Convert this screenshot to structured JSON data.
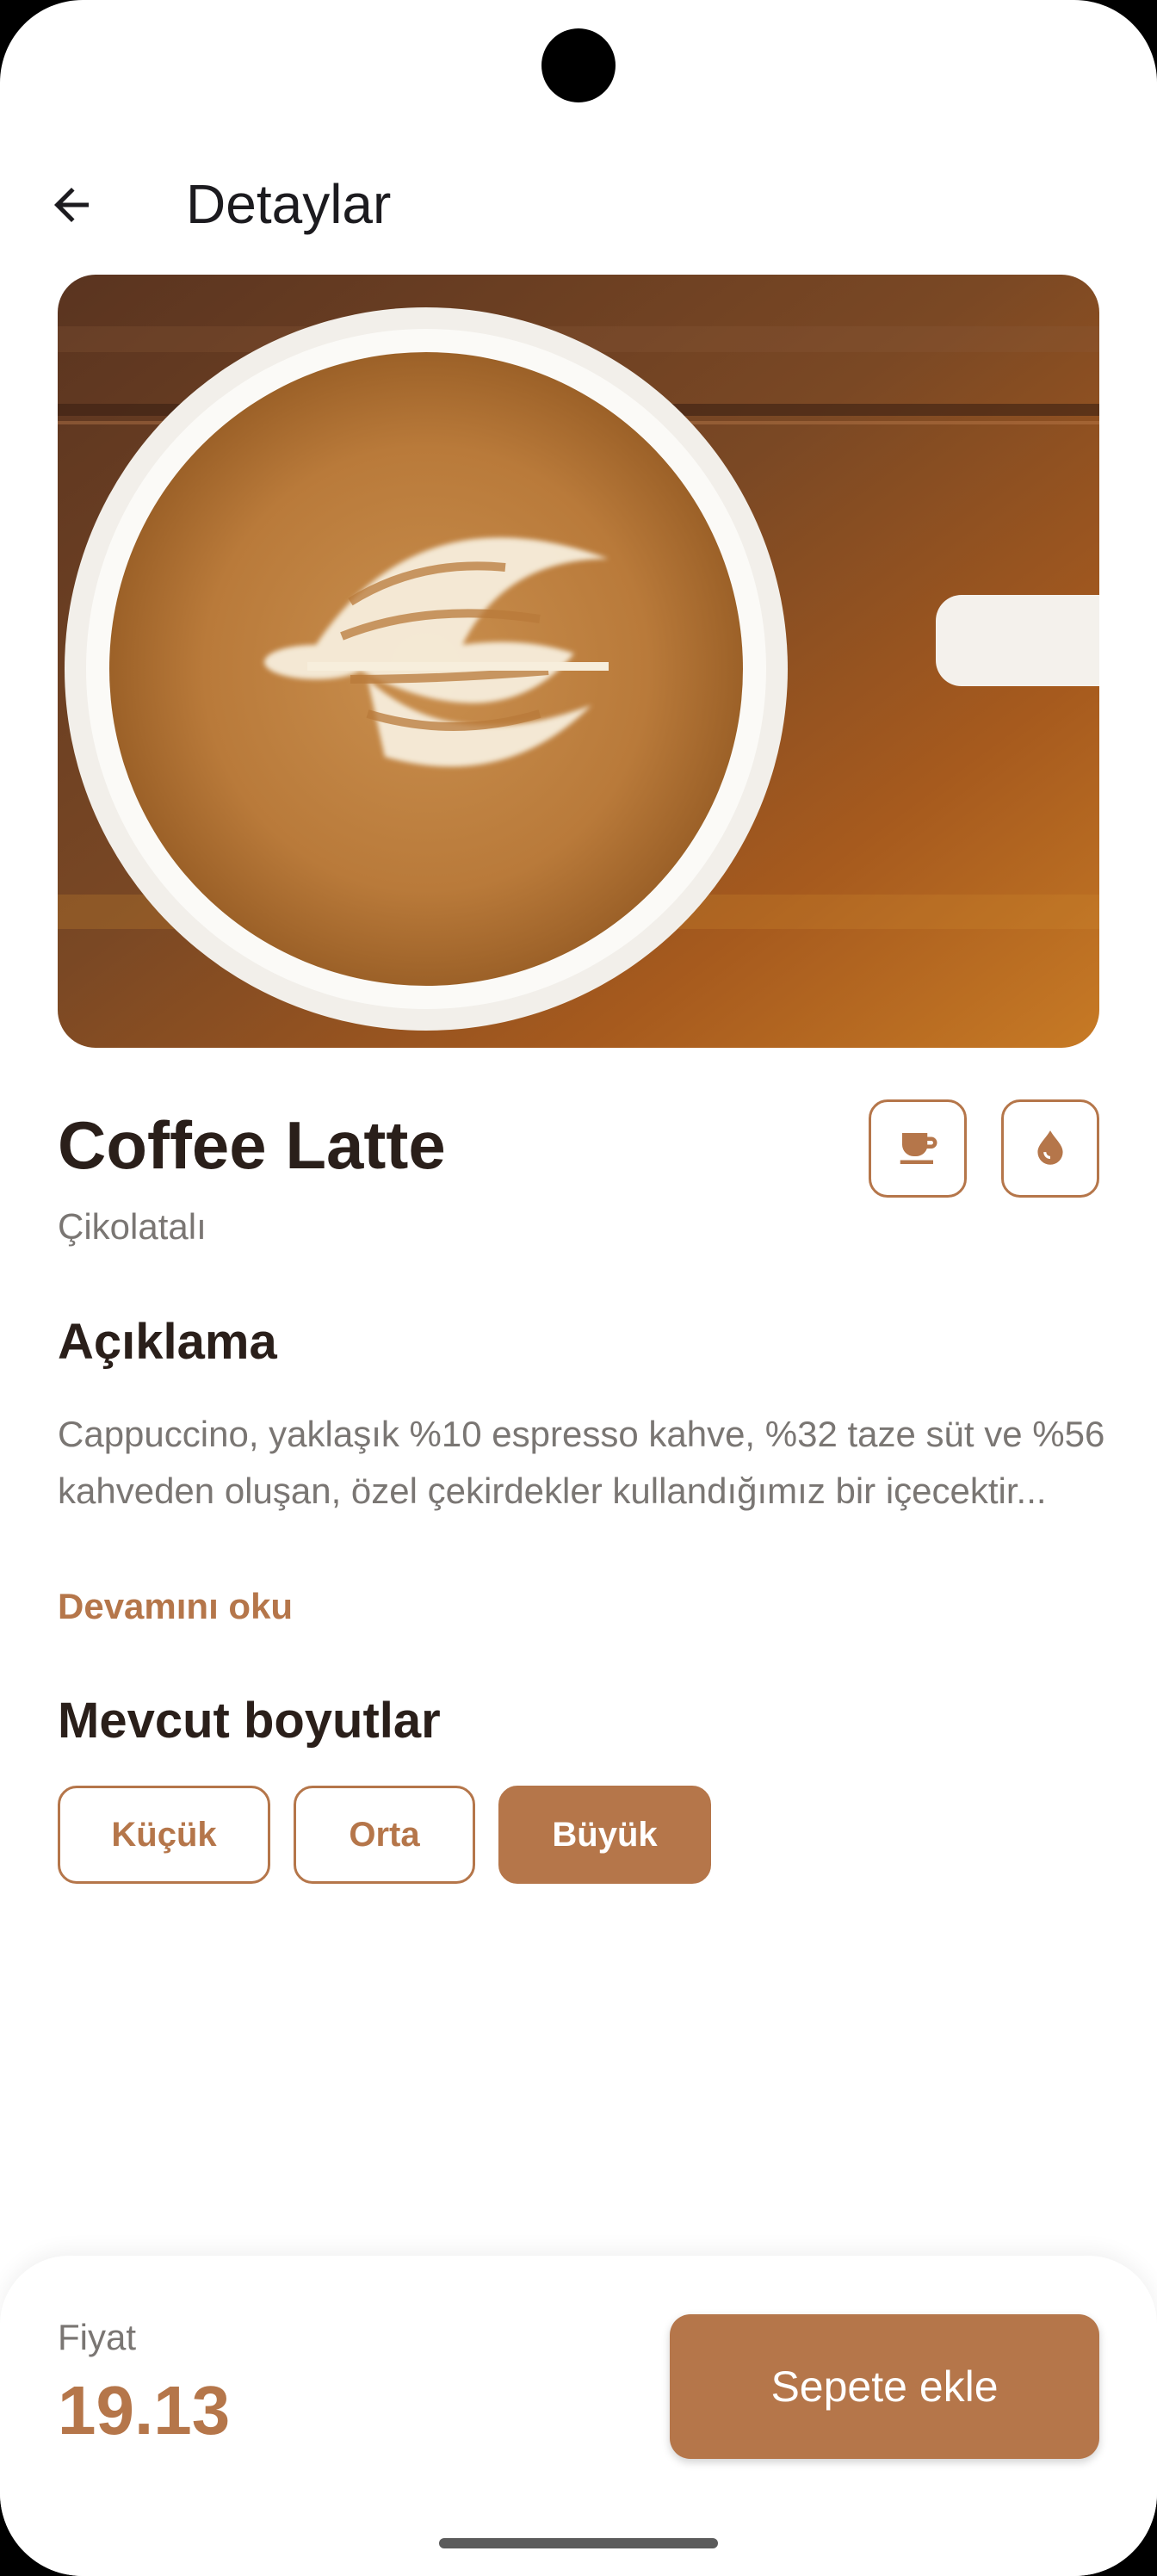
{
  "header": {
    "title": "Detaylar"
  },
  "product": {
    "name": "Coffee Latte",
    "subtitle": "Çikolatalı",
    "image_icon": "coffee-photo",
    "features": [
      {
        "icon": "coffee-cup-icon"
      },
      {
        "icon": "milk-drop-icon"
      }
    ]
  },
  "description": {
    "title": "Açıklama",
    "text": "Cappuccino, yaklaşık %10 espresso kahve, %32 taze süt ve %56 kahveden oluşan, özel çekirdekler kullandığımız bir içecektir...",
    "read_more": "Devamını oku"
  },
  "sizes": {
    "title": "Mevcut boyutlar",
    "options": [
      "Küçük",
      "Orta",
      "Büyük"
    ],
    "selected": "Büyük"
  },
  "footer": {
    "price_label": "Fiyat",
    "price": "19.13",
    "cart_button": "Sepete ekle"
  },
  "colors": {
    "accent": "#b5764a",
    "text_dark": "#2a1f1a",
    "text_muted": "#7a7673"
  }
}
